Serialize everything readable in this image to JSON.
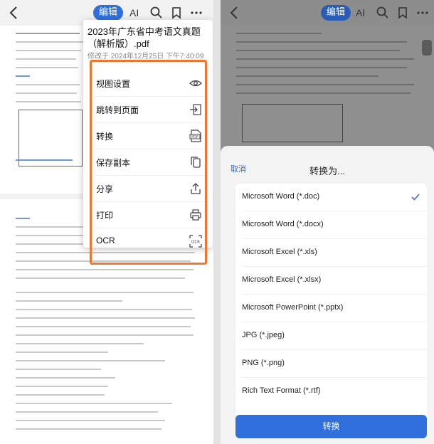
{
  "left_panel": {
    "toolbar": {
      "edit_label": "编辑",
      "ai_label": "AI",
      "icons": [
        "back-arrow-icon",
        "search-icon",
        "bookmark-icon",
        "more-icon"
      ]
    },
    "menu": {
      "file_title": "2023年广东省中考语文真题（解析版）.pdf",
      "modified": "修改于 2024年12月25日 下午7:40:09",
      "items": [
        {
          "label": "视图设置",
          "icon": "eye-icon"
        },
        {
          "label": "跳转到页面",
          "icon": "goto-page-icon"
        },
        {
          "label": "转换",
          "icon": "pdf-convert-icon"
        },
        {
          "label": "保存副本",
          "icon": "copy-icon"
        },
        {
          "label": "分享",
          "icon": "share-icon"
        },
        {
          "label": "打印",
          "icon": "printer-icon"
        },
        {
          "label": "OCR",
          "icon": "ocr-scan-icon"
        }
      ],
      "highlight_color": "#f07531"
    }
  },
  "right_panel": {
    "toolbar": {
      "edit_label": "编辑",
      "ai_label": "AI"
    },
    "sheet": {
      "cancel_label": "取消",
      "title": "转换为...",
      "options": [
        {
          "label": "Microsoft Word (*.doc)",
          "selected": true
        },
        {
          "label": "Microsoft Word (*.docx)",
          "selected": false
        },
        {
          "label": "Microsoft Excel (*.xls)",
          "selected": false
        },
        {
          "label": "Microsoft Excel (*.xlsx)",
          "selected": false
        },
        {
          "label": "Microsoft PowerPoint (*.pptx)",
          "selected": false
        },
        {
          "label": "JPG (*.jpeg)",
          "selected": false
        },
        {
          "label": "PNG (*.png)",
          "selected": false
        },
        {
          "label": "Rich Text Format (*.rtf)",
          "selected": false
        }
      ],
      "convert_label": "转换"
    }
  },
  "colors": {
    "accent": "#2f6fde",
    "check": "#2f6fde"
  }
}
